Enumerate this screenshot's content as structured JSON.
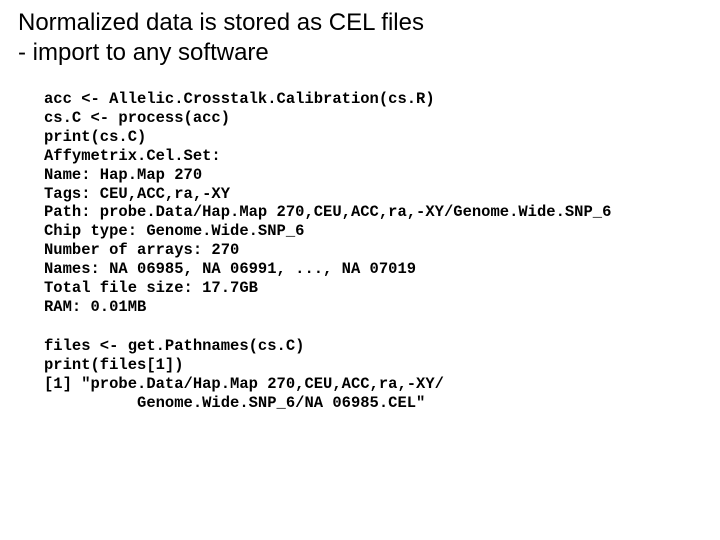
{
  "title_line1": "Normalized data is stored as CEL files",
  "title_line2": "- import to any software",
  "block1": {
    "l1": "acc <- Allelic.Crosstalk.Calibration(cs.R)",
    "l2": "cs.C <- process(acc)",
    "l3": "print(cs.C)",
    "l4": "Affymetrix.Cel.Set:",
    "l5": "Name: Hap.Map 270",
    "l6": "Tags: CEU,ACC,ra,-XY",
    "l7": "Path: probe.Data/Hap.Map 270,CEU,ACC,ra,-XY/Genome.Wide.SNP_6",
    "l8": "Chip type: Genome.Wide.SNP_6",
    "l9": "Number of arrays: 270",
    "l10": "Names: NA 06985, NA 06991, ..., NA 07019",
    "l11": "Total file size: 17.7GB",
    "l12": "RAM: 0.01MB"
  },
  "block2": {
    "l1": "files <- get.Pathnames(cs.C)",
    "l2": "print(files[1])",
    "l3": "[1] \"probe.Data/Hap.Map 270,CEU,ACC,ra,-XY/",
    "l4": "          Genome.Wide.SNP_6/NA 06985.CEL\""
  }
}
